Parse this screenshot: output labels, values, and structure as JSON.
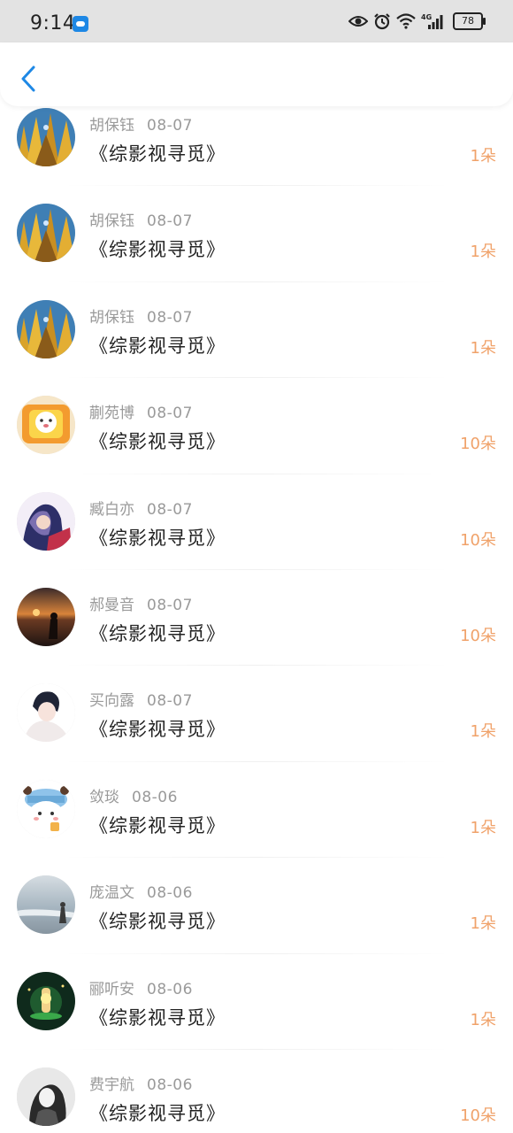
{
  "status_bar": {
    "time": "9:14",
    "network": "4G",
    "battery": "78"
  },
  "colors": {
    "accent": "#1e88e5",
    "count": "#f0a26a",
    "muted": "#9a9a9a"
  },
  "list": [
    {
      "name": "胡保钰",
      "date": "08-07",
      "title": "《综影视寻觅》",
      "count": "1朵",
      "avatar": "autumn-trees-avatar-icon"
    },
    {
      "name": "胡保钰",
      "date": "08-07",
      "title": "《综影视寻觅》",
      "count": "1朵",
      "avatar": "autumn-trees-avatar-icon"
    },
    {
      "name": "胡保钰",
      "date": "08-07",
      "title": "《综影视寻觅》",
      "count": "1朵",
      "avatar": "autumn-trees-avatar-icon"
    },
    {
      "name": "蒯苑博",
      "date": "08-07",
      "title": "《综影视寻觅》",
      "count": "10朵",
      "avatar": "cartoon-dog-avatar-icon"
    },
    {
      "name": "臧白亦",
      "date": "08-07",
      "title": "《综影视寻觅》",
      "count": "10朵",
      "avatar": "anime-couple-avatar-icon"
    },
    {
      "name": "郝曼音",
      "date": "08-07",
      "title": "《综影视寻觅》",
      "count": "10朵",
      "avatar": "sunset-person-avatar-icon"
    },
    {
      "name": "买向露",
      "date": "08-07",
      "title": "《综影视寻觅》",
      "count": "1朵",
      "avatar": "anime-boy-avatar-icon"
    },
    {
      "name": "敛琰",
      "date": "08-06",
      "title": "《综影视寻觅》",
      "count": "1朵",
      "avatar": "cartoon-bear-avatar-icon"
    },
    {
      "name": "庞温文",
      "date": "08-06",
      "title": "《综影视寻觅》",
      "count": "1朵",
      "avatar": "beach-girl-avatar-icon"
    },
    {
      "name": "郦听安",
      "date": "08-06",
      "title": "《综影视寻觅》",
      "count": "1朵",
      "avatar": "glowing-bottle-avatar-icon"
    },
    {
      "name": "费宇航",
      "date": "08-06",
      "title": "《综影视寻觅》",
      "count": "10朵",
      "avatar": "bw-girl-avatar-icon"
    }
  ]
}
